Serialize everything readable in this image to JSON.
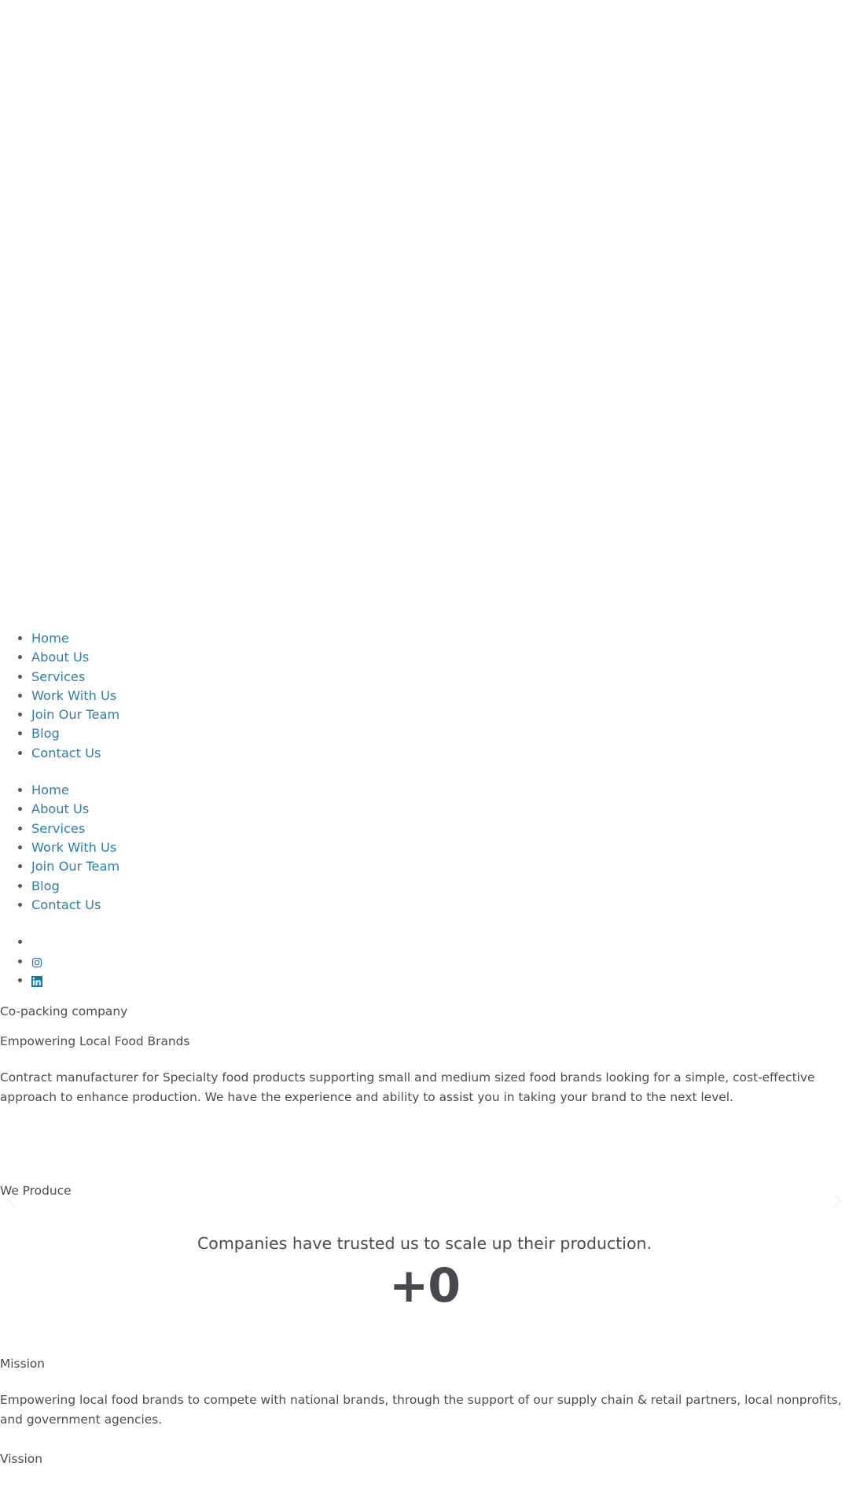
{
  "page": {
    "link_color": "#2d7fa8",
    "text_color": "#4c4c4c",
    "counter_color": "#46494f",
    "chevron_color": "#f2f2f2",
    "background": "#ffffff"
  },
  "primary_nav": {
    "items": [
      {
        "label": "Home"
      },
      {
        "label": "About Us"
      },
      {
        "label": "Services"
      },
      {
        "label": "Work With Us"
      },
      {
        "label": "Join Our Team"
      },
      {
        "label": "Blog"
      },
      {
        "label": "Contact Us"
      }
    ]
  },
  "secondary_nav": {
    "items": [
      {
        "label": "Home"
      },
      {
        "label": "About Us"
      },
      {
        "label": "Services"
      },
      {
        "label": "Work With Us"
      },
      {
        "label": "Join Our Team"
      },
      {
        "label": "Blog"
      },
      {
        "label": "Contact Us"
      }
    ]
  },
  "social": {
    "items": [
      {
        "icon": "blank-icon",
        "label": ""
      },
      {
        "icon": "instagram-icon",
        "label": ""
      },
      {
        "icon": "linkedin-icon",
        "label": ""
      }
    ]
  },
  "hero": {
    "eyebrow": "Co-packing company",
    "title": "Empowering Local Food Brands",
    "body": "Contract manufacturer for Specialty food products supporting small and medium sized food brands looking for a simple, cost-effective approach to enhance production. We have the experience and ability to assist you in taking your brand to the next level."
  },
  "produce": {
    "label": "We Produce",
    "prev_icon": "chevron-left-icon",
    "next_icon": "chevron-right-icon"
  },
  "stats": {
    "caption": "Companies have trusted us to scale up their production.",
    "counter": "+0"
  },
  "mission": {
    "heading": "Mission",
    "body": "Empowering local food brands to compete with national brands, through the support of our supply chain & retail partners, local nonprofits, and government agencies."
  },
  "vision": {
    "heading": "Vission"
  }
}
